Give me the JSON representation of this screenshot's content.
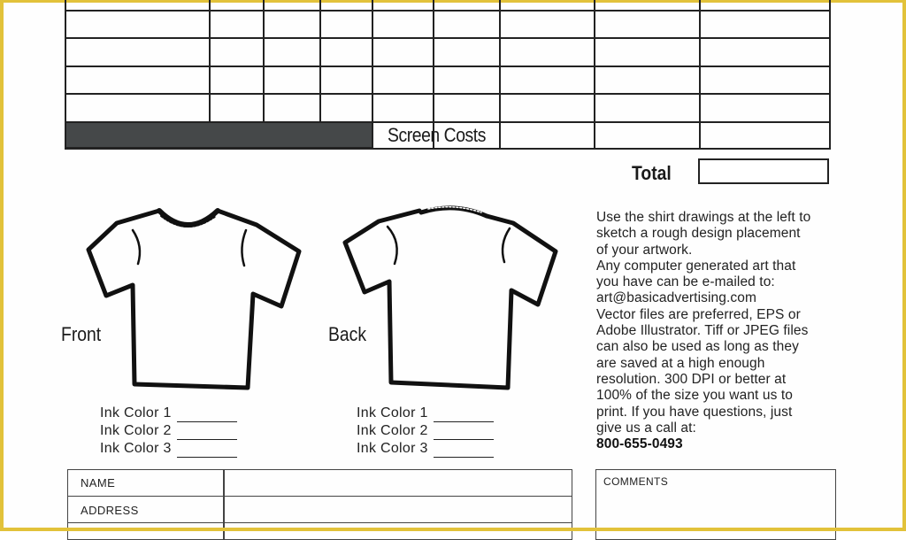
{
  "form": {
    "frame_color": "#e2c23a",
    "order_grid": {
      "columns": 9,
      "rows": 4,
      "cells": [
        [
          "",
          "",
          "",
          "",
          "",
          "",
          "",
          "",
          ""
        ],
        [
          "",
          "",
          "",
          "",
          "",
          "",
          "",
          "",
          ""
        ],
        [
          "",
          "",
          "",
          "",
          "",
          "",
          "",
          "",
          ""
        ],
        [
          "",
          "",
          "",
          "",
          "",
          "",
          "",
          "",
          ""
        ]
      ],
      "screen_costs_label": "Screen Costs",
      "screen_costs_values": [
        "",
        "",
        ""
      ]
    },
    "total": {
      "label": "Total",
      "value": ""
    },
    "front": {
      "label": "Front",
      "ink_colors": [
        {
          "label": "Ink Color 1",
          "value": ""
        },
        {
          "label": "Ink Color 2",
          "value": ""
        },
        {
          "label": "Ink Color 3",
          "value": ""
        }
      ]
    },
    "back": {
      "label": "Back",
      "ink_colors": [
        {
          "label": "Ink Color 1",
          "value": ""
        },
        {
          "label": "Ink Color 2",
          "value": ""
        },
        {
          "label": "Ink Color 3",
          "value": ""
        }
      ]
    },
    "instructions": {
      "lines": [
        "Use the shirt drawings at the left to",
        "sketch a rough design placement",
        "of your artwork.",
        "Any computer generated art that",
        "you have can be e-mailed to:",
        "art@basicadvertising.com",
        "Vector files are preferred, EPS or",
        "Adobe Illustrator. Tiff or JPEG files",
        "can also be used as long as they",
        "are saved at a high enough",
        "resolution. 300 DPI or better at",
        "100% of the size you want us to",
        "print. If you have questions, just",
        "give us a call at:"
      ],
      "phone": "800-655-0493"
    },
    "customer_info": {
      "fields": [
        {
          "label": "NAME",
          "value": ""
        },
        {
          "label": "ADDRESS",
          "value": ""
        }
      ]
    },
    "comments": {
      "label": "COMMENTS",
      "value": ""
    }
  }
}
